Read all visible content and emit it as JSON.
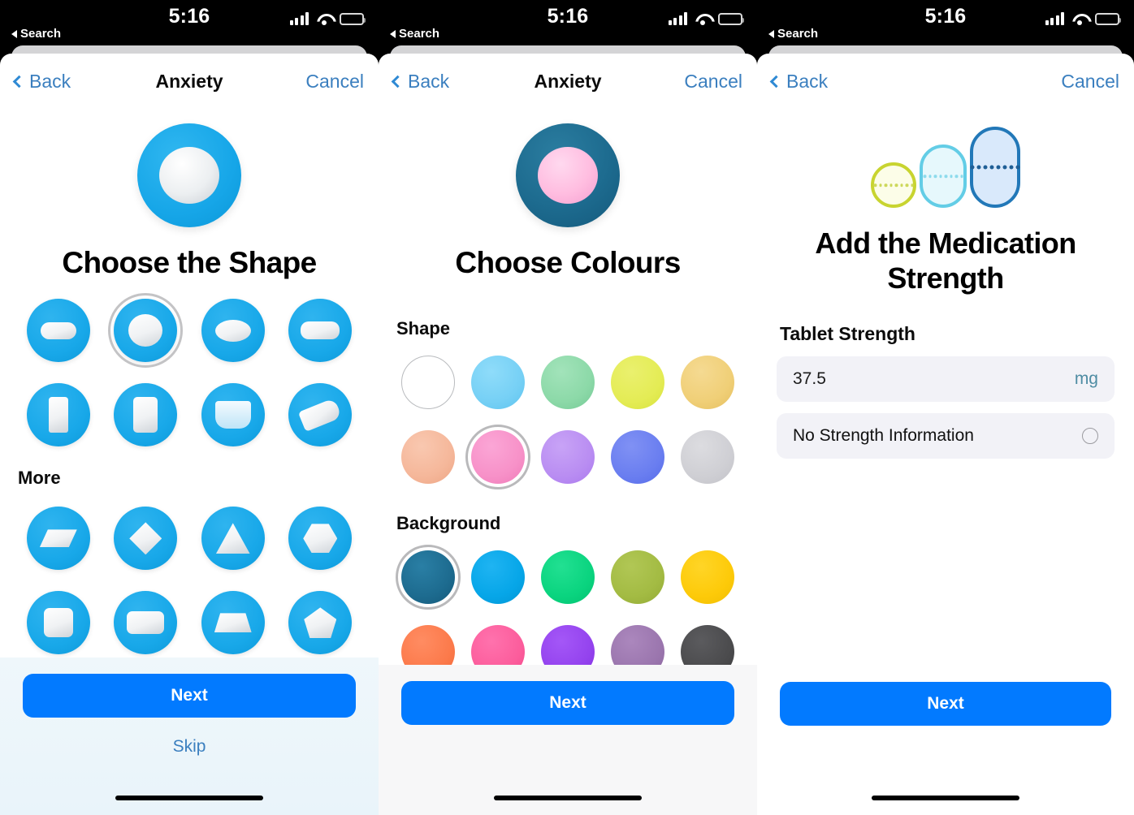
{
  "status_bar": {
    "time": "5:16",
    "back_app": "Search",
    "signal_icon": "cellular-bars-icon",
    "wifi_icon": "wifi-icon",
    "battery_icon": "battery-icon"
  },
  "panels": [
    {
      "nav": {
        "back_label": "Back",
        "title": "Anxiety",
        "cancel_label": "Cancel"
      },
      "hero": {
        "icon_name": "round-white-pill-on-blue-icon",
        "bg_color": "#16a6e8",
        "pill_color": "#ffffff"
      },
      "page_title": "Choose the Shape",
      "shape_options": [
        {
          "name": "capsule",
          "selected": false
        },
        {
          "name": "round",
          "selected": true
        },
        {
          "name": "oval",
          "selected": false
        },
        {
          "name": "oblong",
          "selected": false
        },
        {
          "name": "vial",
          "selected": false
        },
        {
          "name": "pill-bottle",
          "selected": false
        },
        {
          "name": "liquid-cup",
          "selected": false
        },
        {
          "name": "tube",
          "selected": false
        }
      ],
      "more_label": "More",
      "more_options": [
        {
          "name": "flat-rhombus",
          "selected": false
        },
        {
          "name": "diamond",
          "selected": false
        },
        {
          "name": "triangle",
          "selected": false
        },
        {
          "name": "hexagon",
          "selected": false
        },
        {
          "name": "square",
          "selected": false
        },
        {
          "name": "rectangle",
          "selected": false
        },
        {
          "name": "trapezoid",
          "selected": false
        },
        {
          "name": "pentagon",
          "selected": false
        }
      ],
      "footer": {
        "next_label": "Next",
        "skip_label": "Skip"
      }
    },
    {
      "nav": {
        "back_label": "Back",
        "title": "Anxiety",
        "cancel_label": "Cancel"
      },
      "hero": {
        "icon_name": "pink-pill-on-teal-icon",
        "bg_color": "#1d6b8f",
        "pill_color": "#ffbde0"
      },
      "page_title": "Choose Colours",
      "shape_section_label": "Shape",
      "shape_colors": [
        {
          "name": "white",
          "hex": "#ffffff",
          "selected": false,
          "outline": true
        },
        {
          "name": "light-blue",
          "hex": "#76d0f5",
          "selected": false
        },
        {
          "name": "mint-green",
          "hex": "#8cd9a8",
          "selected": false
        },
        {
          "name": "yellow-green",
          "hex": "#e4ec55",
          "selected": false
        },
        {
          "name": "sand-yellow",
          "hex": "#f0cf77",
          "selected": false
        },
        {
          "name": "peach",
          "hex": "#f5b79a",
          "selected": false
        },
        {
          "name": "pink",
          "hex": "#f791c8",
          "selected": true
        },
        {
          "name": "lavender",
          "hex": "#b98df2",
          "selected": false
        },
        {
          "name": "periwinkle",
          "hex": "#6a7ef0",
          "selected": false
        },
        {
          "name": "light-gray",
          "hex": "#cfcfd4",
          "selected": false
        }
      ],
      "background_section_label": "Background",
      "background_colors": [
        {
          "name": "dark-teal",
          "hex": "#1d6b8f",
          "selected": true
        },
        {
          "name": "bright-blue",
          "hex": "#06a6e8",
          "selected": false
        },
        {
          "name": "emerald-green",
          "hex": "#0ad47f",
          "selected": false
        },
        {
          "name": "olive-green",
          "hex": "#a3bb43",
          "selected": false
        },
        {
          "name": "golden-yellow",
          "hex": "#fdca09",
          "selected": false
        },
        {
          "name": "coral-orange",
          "hex": "#fc7a4b",
          "selected": false
        },
        {
          "name": "hot-pink",
          "hex": "#fc5d9c",
          "selected": false
        },
        {
          "name": "purple",
          "hex": "#9443ee",
          "selected": false
        },
        {
          "name": "muted-purple",
          "hex": "#9b76ae",
          "selected": false
        },
        {
          "name": "dark-gray",
          "hex": "#4b4b4d",
          "selected": false
        }
      ],
      "footer": {
        "next_label": "Next"
      }
    },
    {
      "nav": {
        "back_label": "Back",
        "title": "",
        "cancel_label": "Cancel"
      },
      "hero": {
        "icon_name": "three-pill-outlines-icon"
      },
      "page_title": "Add the Medication Strength",
      "field_label": "Tablet Strength",
      "strength_value": "37.5",
      "strength_unit": "mg",
      "no_strength_label": "No Strength Information",
      "no_strength_selected": false,
      "footer": {
        "next_label": "Next"
      }
    }
  ]
}
